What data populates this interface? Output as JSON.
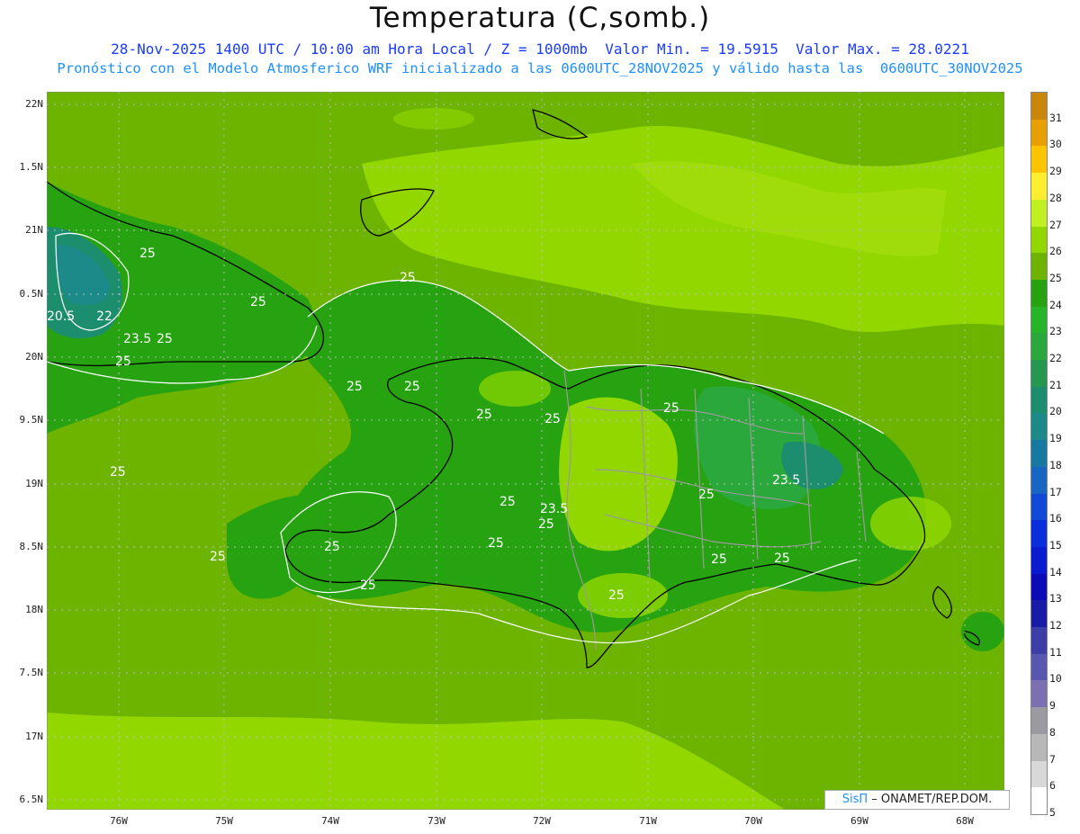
{
  "header": {
    "title": "Temperatura (C,somb.)",
    "line1": "28-Nov-2025 1400 UTC / 10:00 am Hora Local / Z = 1000mb  Valor Min. = 19.5915  Valor Max. = 28.0221",
    "line2": "Pronóstico con el Modelo Atmosferico WRF inicializado a las 0600UTC_28NOV2025 y válido hasta las  0600UTC_30NOV2025"
  },
  "axes": {
    "lat_labels": [
      "22N",
      "1.5N",
      "21N",
      "0.5N",
      "20N",
      "9.5N",
      "19N",
      "8.5N",
      "18N",
      "7.5N",
      "17N",
      "6.5N"
    ],
    "lon_labels": [
      "76W",
      "75W",
      "74W",
      "73W",
      "72W",
      "71W",
      "70W",
      "69W",
      "68W"
    ]
  },
  "legend": {
    "levels": [
      "31",
      "30",
      "29",
      "28",
      "27",
      "26",
      "25",
      "24",
      "23",
      "22",
      "21",
      "20",
      "19",
      "18",
      "17",
      "16",
      "15",
      "14",
      "13",
      "12",
      "11",
      "10",
      "9",
      "8",
      "7",
      "6",
      "5"
    ],
    "colors": [
      "#c8860a",
      "#e8a000",
      "#ffc400",
      "#ffee30",
      "#c0f020",
      "#92d800",
      "#6cb400",
      "#27a312",
      "#28b428",
      "#2aa83c",
      "#259750",
      "#1d8e6d",
      "#1d8a8a",
      "#1779a1",
      "#1766c2",
      "#1248d8",
      "#0a2edc",
      "#0a1bd0",
      "#0b0cb8",
      "#1a1aa8",
      "#3d3da8",
      "#5858b0",
      "#7c70b2",
      "#9a9aa0",
      "#b8b8b8",
      "#d8d8d8",
      "#ffffff"
    ]
  },
  "contour_labels": [
    "25",
    "25",
    "20.5",
    "22",
    "23.5",
    "25",
    "25",
    "25",
    "25",
    "25",
    "25",
    "25",
    "25",
    "23.5",
    "25",
    "25",
    "25",
    "25",
    "25",
    "25",
    "25",
    "25",
    "23.5",
    "25",
    "25",
    "25"
  ],
  "credit": {
    "brand": "SisΠ",
    "org": "– ONAMET/REP.DOM."
  }
}
